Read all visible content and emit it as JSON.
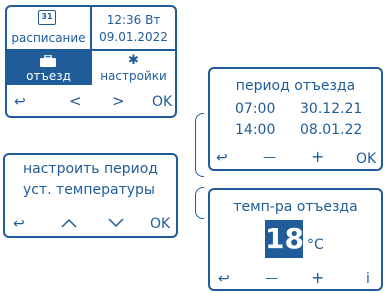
{
  "main": {
    "calendar_number": "31",
    "schedule_label": "расписание",
    "time": "12:36 Вт",
    "date": "09.01.2022",
    "away_label": "отъезд",
    "settings_label": "настройки",
    "nav_ok": "OK"
  },
  "period": {
    "title": "период отъезда",
    "row1_time": "07:00",
    "row1_date": "30.12.21",
    "row2_time": "14:00",
    "row2_date": "08.01.22",
    "minus": "—",
    "plus": "+",
    "ok": "OK"
  },
  "config": {
    "line1": "настроить период",
    "line2": "уст. температуры",
    "ok": "OK"
  },
  "temp": {
    "title": "темп-ра отъезда",
    "value": "18",
    "unit": "°C",
    "minus": "—",
    "plus": "+",
    "info": "i"
  },
  "colors": {
    "accent": "#1f5c99"
  }
}
